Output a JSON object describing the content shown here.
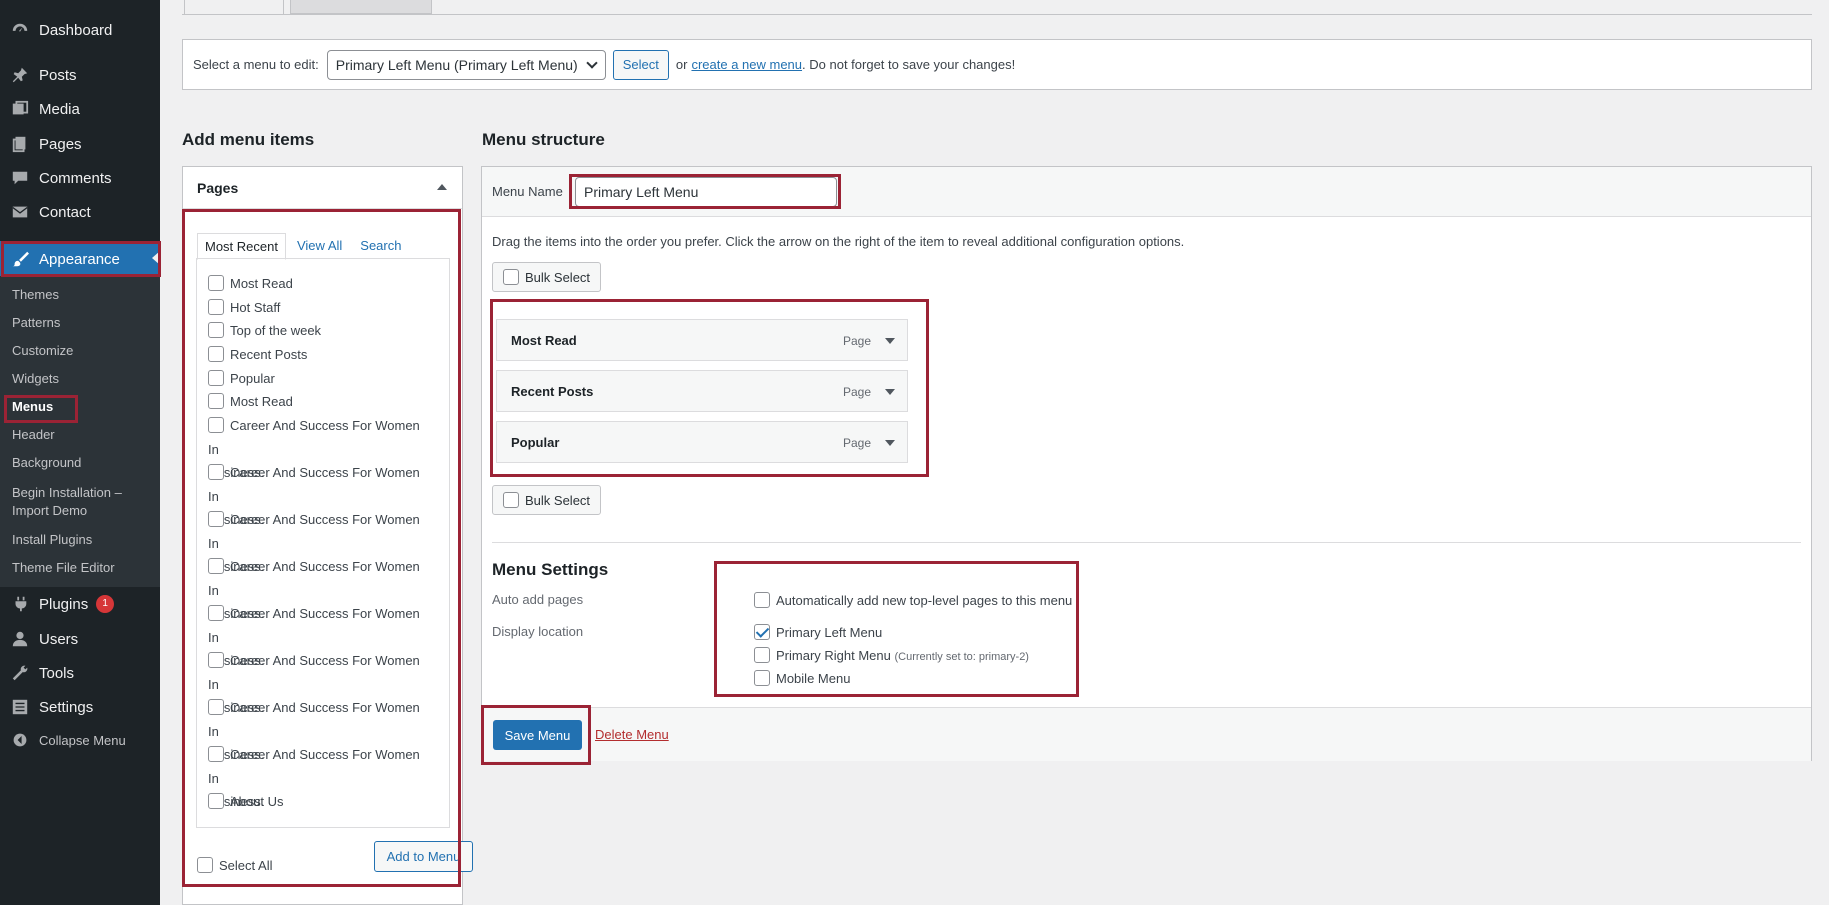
{
  "sidebar": {
    "items": [
      {
        "label": "Dashboard",
        "icon": "dashboard-icon"
      },
      {
        "label": "Posts",
        "icon": "pin-icon"
      },
      {
        "label": "Media",
        "icon": "media-icon"
      },
      {
        "label": "Pages",
        "icon": "pages-icon"
      },
      {
        "label": "Comments",
        "icon": "comment-icon"
      },
      {
        "label": "Contact",
        "icon": "mail-icon"
      },
      {
        "label": "Appearance",
        "icon": "brush-icon"
      },
      {
        "label": "Plugins",
        "icon": "plug-icon",
        "badge": "1"
      },
      {
        "label": "Users",
        "icon": "user-icon"
      },
      {
        "label": "Tools",
        "icon": "wrench-icon"
      },
      {
        "label": "Settings",
        "icon": "settings-icon"
      },
      {
        "label": "Collapse Menu",
        "icon": "collapse-icon"
      }
    ],
    "submenu": [
      "Themes",
      "Patterns",
      "Customize",
      "Widgets",
      "Menus",
      "Header",
      "Background",
      "Begin Installation –",
      "Import Demo",
      "Install Plugins",
      "Theme File Editor"
    ]
  },
  "select_bar": {
    "label": "Select a menu to edit:",
    "selected": "Primary Left Menu (Primary Left Menu)",
    "select_button": "Select",
    "or": "or",
    "create_link": "create a new menu",
    "suffix": ". Do not forget to save your changes!"
  },
  "add_items": {
    "heading": "Add menu items",
    "panel_title": "Pages",
    "tabs": [
      "Most Recent",
      "View All",
      "Search"
    ],
    "pages": [
      [
        "Most Read"
      ],
      [
        "Hot Staff"
      ],
      [
        "Top of the week"
      ],
      [
        "Recent Posts"
      ],
      [
        "Popular"
      ],
      [
        "Most Read"
      ],
      [
        "Career And Success For Women In",
        "Business."
      ],
      [
        "Career And Success For Women In",
        "Business."
      ],
      [
        "Career And Success For Women In",
        "Business."
      ],
      [
        "Career And Success For Women In",
        "Business."
      ],
      [
        "Career And Success For Women In",
        "Business."
      ],
      [
        "Career And Success For Women In",
        "Business."
      ],
      [
        "Career And Success For Women In",
        "Business."
      ],
      [
        "Career And Success For Women In",
        "Business."
      ],
      [
        "About Us"
      ]
    ],
    "select_all": "Select All",
    "add_button": "Add to Menu"
  },
  "structure": {
    "heading": "Menu structure",
    "name_label": "Menu Name",
    "name_value": "Primary Left Menu",
    "description": "Drag the items into the order you prefer. Click the arrow on the right of the item to reveal additional configuration options.",
    "bulk_select": "Bulk Select",
    "items": [
      {
        "title": "Most Read",
        "kind": "Page"
      },
      {
        "title": "Recent Posts",
        "kind": "Page"
      },
      {
        "title": "Popular",
        "kind": "Page"
      }
    ],
    "settings": {
      "heading": "Menu Settings",
      "auto_add_label": "Auto add pages",
      "auto_add_option": "Automatically add new top-level pages to this menu",
      "display_label": "Display location",
      "locations": [
        {
          "label": "Primary Left Menu",
          "note": "",
          "checked": true
        },
        {
          "label": "Primary Right Menu",
          "note": "(Currently set to: primary-2)",
          "checked": false
        },
        {
          "label": "Mobile Menu",
          "note": "",
          "checked": false
        }
      ]
    },
    "save_button": "Save Menu",
    "delete_link": "Delete Menu"
  },
  "colors": {
    "accent": "#2271b1",
    "sidebar_bg": "#1d2327",
    "highlight_box": "#9b2335",
    "badge": "#d63638"
  }
}
